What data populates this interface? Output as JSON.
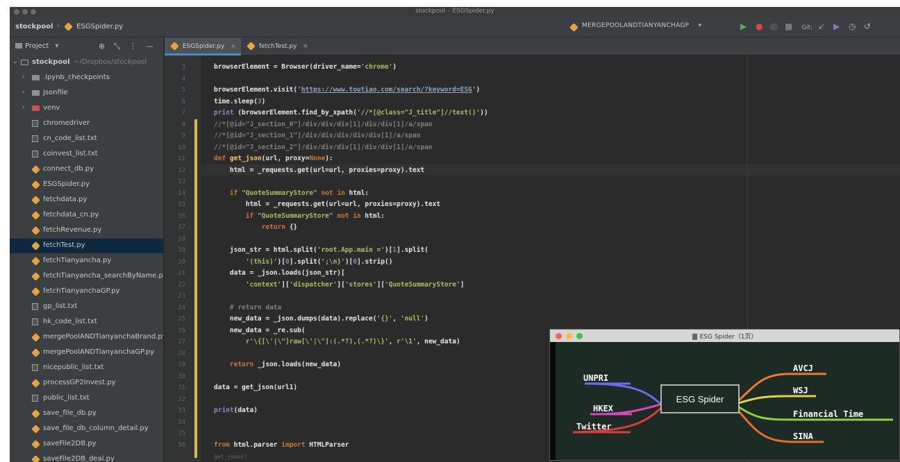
{
  "window": {
    "title": "stockpool – ESGSpider.py"
  },
  "navbar": {
    "project": "stockpool",
    "file": "ESGSpider.py",
    "run_config": "MERGEPOOLANDTIANYANCHAGP",
    "git_label": "Git:"
  },
  "sidebar": {
    "header_label": "Project",
    "root_label": "stockpool",
    "root_path": "~/Dropbox/stockpool",
    "items": [
      {
        "label": ".ipynb_checkpoints",
        "type": "folder"
      },
      {
        "label": "jsonfile",
        "type": "folder"
      },
      {
        "label": "venv",
        "type": "folder-red"
      },
      {
        "label": "chromedriver",
        "type": "text"
      },
      {
        "label": "cn_code_list.txt",
        "type": "text"
      },
      {
        "label": "coinvest_list.txt",
        "type": "text"
      },
      {
        "label": "connect_db.py",
        "type": "py"
      },
      {
        "label": "ESGSpider.py",
        "type": "py"
      },
      {
        "label": "fetchdata.py",
        "type": "py"
      },
      {
        "label": "fetchdata_cn.py",
        "type": "py"
      },
      {
        "label": "fetchRevenue.py",
        "type": "py"
      },
      {
        "label": "fetchTest.py",
        "type": "py"
      },
      {
        "label": "fetchTianyancha.py",
        "type": "py"
      },
      {
        "label": "fetchTianyancha_searchByName.py",
        "type": "py"
      },
      {
        "label": "fetchTianyanchaGP.py",
        "type": "py"
      },
      {
        "label": "gp_list.txt",
        "type": "text"
      },
      {
        "label": "hk_code_list.txt",
        "type": "text"
      },
      {
        "label": "mergePoolANDTianyanchaBrand.py",
        "type": "py"
      },
      {
        "label": "mergePoolANDTianyanchaGP.py",
        "type": "py"
      },
      {
        "label": "nicepublic_list.txt",
        "type": "text"
      },
      {
        "label": "processGP2Invest.py",
        "type": "py"
      },
      {
        "label": "public_list.txt",
        "type": "text"
      },
      {
        "label": "save_file_db.py",
        "type": "py"
      },
      {
        "label": "save_file_db_column_detail.py",
        "type": "py"
      },
      {
        "label": "saveFile2DB.py",
        "type": "py"
      },
      {
        "label": "saveFile2DB_deal.py",
        "type": "py"
      }
    ]
  },
  "tabs": [
    {
      "label": "ESGSpider.py",
      "active": true
    },
    {
      "label": "fetchTest.py",
      "active": false
    }
  ],
  "editor": {
    "lines": [
      {
        "n": "3",
        "html": "browserElement = Browser(driver_name=<span class=\"s\">'chrome'</span>)"
      },
      {
        "n": "4",
        "html": ""
      },
      {
        "n": "5",
        "html": "browserElement.visit(<span class=\"s\">'</span><span class=\"u\">https://www.toutiao.com/search/?keyword=ESG</span><span class=\"s\">'</span>)"
      },
      {
        "n": "6",
        "html": "time.sleep(<span class=\"n\">3</span>)"
      },
      {
        "n": "7",
        "html": "<span class=\"b\">print</span> (browserElement.find_by_xpath(<span class=\"s\">'//*[@class=\"J_title\"]//text()'</span>))"
      },
      {
        "n": "8",
        "html": "<span class=\"c\">//*[@id=\"J_section_0\"]/div/div/div[1]/div/div[1]/a/span</span>"
      },
      {
        "n": "9",
        "html": "<span class=\"c\">//*[@id=\"J_section_1\"]/div/div/div/div/div[1]/a/span</span>"
      },
      {
        "n": "10",
        "html": "<span class=\"c\">//*[@id=\"J_section_2\"]/div/div/div[1]/div/div[1]/a/span</span>"
      },
      {
        "n": "11",
        "html": "<span class=\"k\">def</span> <span class=\"f\">get_json</span>(url, proxy=<span class=\"k\">None</span>):"
      },
      {
        "n": "12",
        "html": "    html = _requests.get(url=url, proxies=proxy).text"
      },
      {
        "n": "13",
        "html": ""
      },
      {
        "n": "14",
        "html": "    <span class=\"k\">if</span> <span class=\"s\">\"QuoteSummaryStore\"</span> <span class=\"k\">not in</span> html:"
      },
      {
        "n": "15",
        "html": "        html = _requests.get(url=url, proxies=proxy).text"
      },
      {
        "n": "16",
        "html": "        <span class=\"k\">if</span> <span class=\"s\">\"QuoteSummaryStore\"</span> <span class=\"k\">not in</span> html:"
      },
      {
        "n": "17",
        "html": "            <span class=\"k\">return</span> {}"
      },
      {
        "n": "18",
        "html": ""
      },
      {
        "n": "19",
        "html": "    json_str = html.split(<span class=\"s\">'root.App.main ='</span>)[<span class=\"n\">1</span>].split("
      },
      {
        "n": "20",
        "html": "        <span class=\"s\">'(this)'</span>)[<span class=\"n\">0</span>].split(<span class=\"s\">';\\n}'</span>)[<span class=\"n\">0</span>].strip()"
      },
      {
        "n": "21",
        "html": "    data = _json.loads(json_str)["
      },
      {
        "n": "22",
        "html": "        <span class=\"s\">'context'</span>][<span class=\"s\">'dispatcher'</span>][<span class=\"s\">'stores'</span>][<span class=\"s\">'QuoteSummaryStore'</span>]"
      },
      {
        "n": "23",
        "html": ""
      },
      {
        "n": "24",
        "html": "    <span class=\"c\"># return data</span>"
      },
      {
        "n": "25",
        "html": "    new_data = _json.dumps(data).replace(<span class=\"s\">'{}'</span>, <span class=\"s\">'null'</span>)"
      },
      {
        "n": "26",
        "html": "    new_data = _re.sub("
      },
      {
        "n": "27",
        "html": "        <span class=\"s\">r'\\{[\\'|\\\"]raw[\\'|\\\"]:(.*?),(.*?)\\}'</span>, <span class=\"s\">r'\\1'</span>, new_data)"
      },
      {
        "n": "28",
        "html": ""
      },
      {
        "n": "29",
        "html": "    <span class=\"k\">return</span> _json.loads(new_data)"
      },
      {
        "n": "30",
        "html": ""
      },
      {
        "n": "31",
        "html": "data = get_json(url1)"
      },
      {
        "n": "32",
        "html": ""
      },
      {
        "n": "33",
        "html": "<span class=\"b\">print</span>(data)"
      },
      {
        "n": "34",
        "html": ""
      },
      {
        "n": "35",
        "html": ""
      },
      {
        "n": "36",
        "html": "<span class=\"k\">from</span> html.parser <span class=\"k\">import</span> HTMLParser"
      }
    ],
    "footer_hint": "get_json()"
  },
  "floating_window": {
    "title": "ESG Spider（1页）"
  },
  "mindmap": {
    "center": "ESG Spider",
    "left_nodes": [
      {
        "label": "UNPRI",
        "color": "#6c6cf0"
      },
      {
        "label": "HKEX",
        "color": "#d846b8"
      },
      {
        "label": "Twitter",
        "color": "#e03a3a"
      }
    ],
    "right_nodes": [
      {
        "label": "AVCJ",
        "color": "#f07a2a"
      },
      {
        "label": "WSJ",
        "color": "#e8d23a"
      },
      {
        "label": "Financial Time",
        "color": "#8cd23a"
      },
      {
        "label": "SINA",
        "color": "#f06a2a"
      }
    ]
  }
}
